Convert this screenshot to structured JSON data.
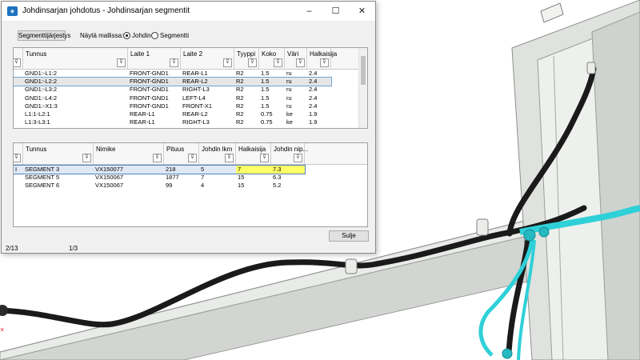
{
  "window": {
    "title": "Johdinsarjan johdotus - Johdinsarjan segmentit",
    "app_icon": "app-logo-icon",
    "minimize_icon": "–",
    "maximize_icon": "☐",
    "close_icon": "✕"
  },
  "toolbar": {
    "order_button": "Segmenttijärjestys",
    "show_in_model_label": "Näytä mallissa:",
    "option_wire": "Johdin",
    "option_segment": "Segmentti",
    "selected_option": "Johdin"
  },
  "wires": {
    "columns": [
      "Tunnus",
      "Laite 1",
      "Laite 2",
      "Tyyppi",
      "Koko",
      "Väri",
      "Halkaisija"
    ],
    "rows": [
      [
        "GND1:-L1:2",
        "FRONT-GND1",
        "REAR-L1",
        "R2",
        "1.5",
        "ru",
        "2.4"
      ],
      [
        "GND1:-L2:2",
        "FRONT-GND1",
        "REAR-L2",
        "R2",
        "1.5",
        "ru",
        "2.4"
      ],
      [
        "GND1:-L3:2",
        "FRONT-GND1",
        "RIGHT-L3",
        "R2",
        "1.5",
        "ru",
        "2.4"
      ],
      [
        "GND1:-L4:2",
        "FRONT-GND1",
        "LEFT-L4",
        "R2",
        "1.5",
        "ru",
        "2.4"
      ],
      [
        "GND1:-X1:3",
        "FRONT-GND1",
        "FRONT-X1",
        "R2",
        "1.5",
        "ru",
        "2.4"
      ],
      [
        "L1:1-L2:1",
        "REAR-L1",
        "REAR-L2",
        "R2",
        "0.75",
        "ke",
        "1.9"
      ],
      [
        "L1:3-L3:1",
        "REAR-L1",
        "RIGHT-L3",
        "R2",
        "0.75",
        "ke",
        "1.9"
      ]
    ],
    "selected_row": 1
  },
  "segments": {
    "columns": [
      "Tunnus",
      "Nimike",
      "Pituus",
      "Johdin lkm",
      "Halkaisija",
      "Johdin nip..."
    ],
    "rows": [
      [
        "SEGMENT 3",
        "VX150077",
        "218",
        "5",
        "7",
        "7.3"
      ],
      [
        "SEGMENT 5",
        "VX150067",
        "1877",
        "7",
        "15",
        "6.3"
      ],
      [
        "SEGMENT 6",
        "VX150067",
        "99",
        "4",
        "15",
        "5.2"
      ]
    ],
    "selected_row": 0,
    "row_marker": "I"
  },
  "close_button": "Sulje",
  "status": {
    "left": "2/13",
    "right": "1/3"
  },
  "colors": {
    "cable_black": "#1a1a1a",
    "cable_cyan": "#2fd0d8",
    "highlight_yellow": "#ffff66",
    "selection_blue": "#4f81bd",
    "frame_grey": "#d9dcd8"
  }
}
